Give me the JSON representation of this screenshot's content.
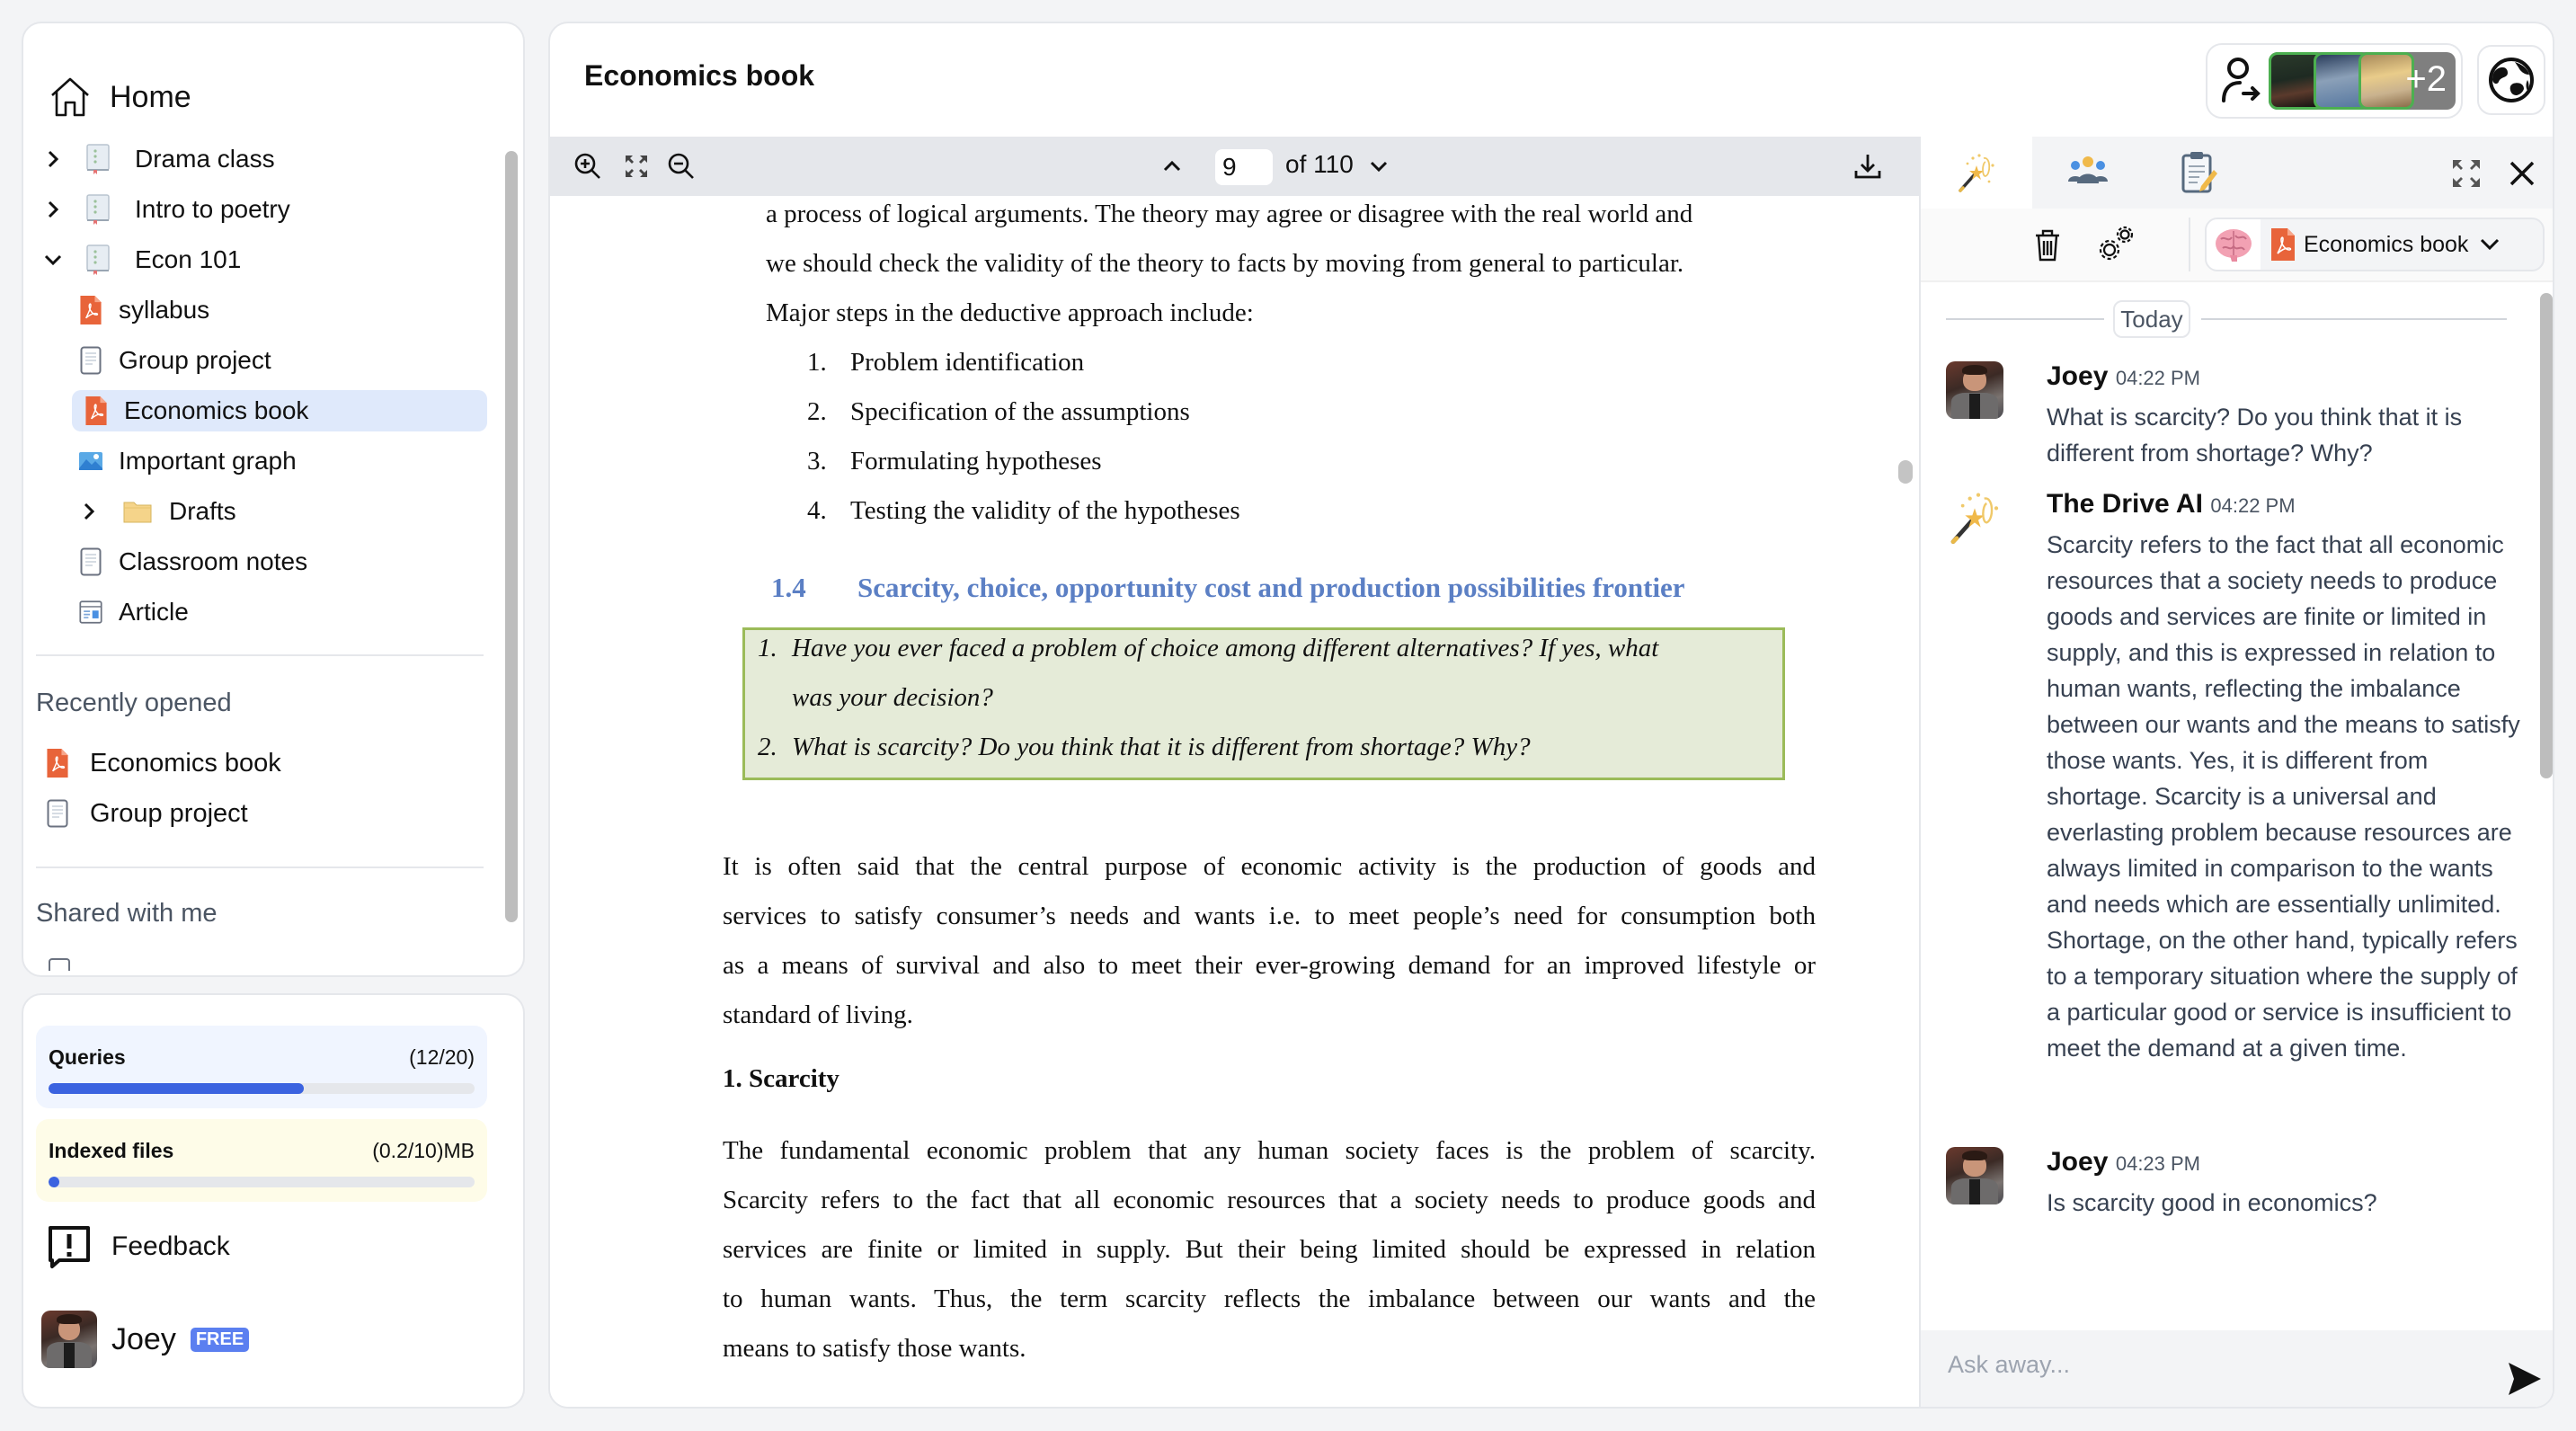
{
  "sidebar": {
    "home_label": "Home",
    "tree": [
      {
        "label": "Drama class",
        "type": "notebook",
        "expandable": true,
        "expanded": false,
        "level": 0
      },
      {
        "label": "Intro to poetry",
        "type": "notebook",
        "expandable": true,
        "expanded": false,
        "level": 0
      },
      {
        "label": "Econ 101",
        "type": "notebook",
        "expandable": true,
        "expanded": true,
        "level": 0
      },
      {
        "label": "syllabus",
        "type": "pdf",
        "level": 1
      },
      {
        "label": "Group project",
        "type": "doc",
        "level": 1
      },
      {
        "label": "Economics book",
        "type": "pdf",
        "level": 1,
        "selected": true
      },
      {
        "label": "Important graph",
        "type": "image",
        "level": 1
      },
      {
        "label": "Drafts",
        "type": "folder",
        "expandable": true,
        "expanded": false,
        "level": 1
      },
      {
        "label": "Classroom notes",
        "type": "doc",
        "level": 1
      },
      {
        "label": "Article",
        "type": "webpage",
        "level": 1
      }
    ],
    "recently_opened_label": "Recently opened",
    "recently_opened": [
      {
        "label": "Economics book",
        "type": "pdf"
      },
      {
        "label": "Group project",
        "type": "doc"
      }
    ],
    "shared_label": "Shared with me"
  },
  "usage": {
    "queries": {
      "label": "Queries",
      "value": "(12/20)",
      "fraction": 0.6
    },
    "indexed": {
      "label": "Indexed files",
      "value": "(0.2/10)MB",
      "fraction": 0.02
    }
  },
  "feedback_label": "Feedback",
  "user": {
    "name": "Joey",
    "plan": "FREE"
  },
  "header": {
    "title": "Economics book",
    "collaborators_extra": "+2"
  },
  "pdf": {
    "current_page": "9",
    "page_total": "of 110",
    "lines_top": [
      "a process of logical arguments. The theory may agree or disagree with the real world and",
      "we should check the validity of the theory to facts by moving from general to particular.",
      "Major steps in the deductive approach include:"
    ],
    "steps": [
      {
        "num": "1.",
        "text": "Problem identification"
      },
      {
        "num": "2.",
        "text": "Specification of the assumptions"
      },
      {
        "num": "3.",
        "text": "Formulating hypotheses"
      },
      {
        "num": "4.",
        "text": "Testing the validity of the hypotheses"
      }
    ],
    "section_number": "1.4",
    "section_title": "Scarcity, choice, opportunity cost and production possibilities frontier",
    "callout": [
      {
        "num": "1.",
        "line1": "Have you ever faced a problem of choice among different alternatives? If yes, what",
        "line2": "was your decision?"
      },
      {
        "num": "2.",
        "line1": "What is scarcity? Do you think that it is different from shortage? Why?"
      }
    ],
    "para1": [
      "It is often said that the central purpose of economic activity is the production of goods and",
      "services to satisfy consumer’s needs and wants i.e. to meet people’s need for consumption both",
      "as a means of survival and also to meet their ever-growing demand for an improved lifestyle or",
      "standard of living."
    ],
    "subheading": "1. Scarcity",
    "para2": [
      "The fundamental economic problem that any human society faces is the problem of scarcity.",
      "Scarcity refers to the fact that all economic resources that a society needs to produce goods and",
      "services are finite or limited in supply. But their being limited should be expressed in relation",
      "to human wants. Thus, the term scarcity reflects the imbalance between our wants and the",
      "means to satisfy those wants."
    ]
  },
  "chat": {
    "context_label": "Economics book",
    "date_separator": "Today",
    "messages": [
      {
        "author": "Joey",
        "time": "04:22 PM",
        "text": "What is scarcity? Do you think that it is different from shortage? Why?"
      },
      {
        "author": "The Drive AI",
        "time": "04:22 PM",
        "text": "Scarcity refers to the fact that all economic resources that a society needs to produce goods and services are finite or limited in supply, and this is expressed in relation to human wants, reflecting the imbalance between our wants and the means to satisfy those wants. Yes, it is different from shortage. Scarcity is a universal and everlasting problem because resources are always limited in comparison to the wants and needs which are essentially unlimited. Shortage, on the other hand, typically refers to a temporary situation where the supply of a particular good or service is insufficient to meet the demand at a given time."
      },
      {
        "author": "Joey",
        "time": "04:23 PM",
        "text": "Is scarcity good in economics?"
      }
    ],
    "input_placeholder": "Ask away...",
    "input_value": ""
  },
  "colors": {
    "accent": "#3b63e0",
    "selected_bg": "#dfe9fb",
    "pdf_heading": "#5b7fc4",
    "callout_bg": "#e5ebd8",
    "callout_border": "#9bbb59",
    "queries_bg": "#f0f5ff",
    "indexed_bg": "#fefce8",
    "free_badge": "#5b7ff0"
  }
}
